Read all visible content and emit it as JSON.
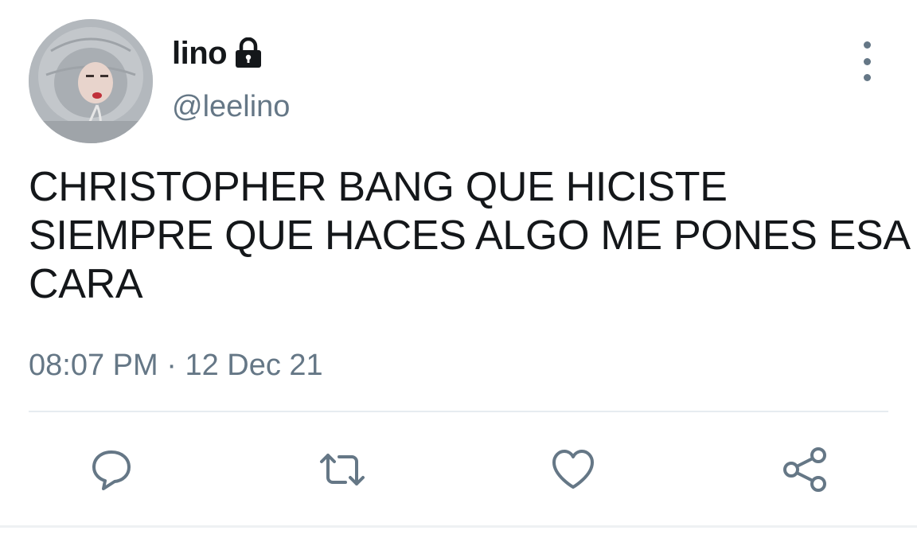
{
  "user": {
    "display_name": "lino",
    "handle": "@leelino",
    "avatar_icon": "avatar-photo",
    "protected_icon": "lock-icon"
  },
  "tweet": {
    "text_lines": [
      "CHRISTOPHER BANG QUE HICISTE",
      "SIEMPRE QUE HACES ALGO ME PONES ESA",
      "CARA"
    ],
    "time": "08:07 PM",
    "separator": "·",
    "date": "12 Dec 21"
  },
  "actions": [
    {
      "name": "reply",
      "icon": "reply-icon"
    },
    {
      "name": "retweet",
      "icon": "retweet-icon"
    },
    {
      "name": "like",
      "icon": "heart-icon"
    },
    {
      "name": "share",
      "icon": "share-icon"
    }
  ],
  "colors": {
    "text": "#14171a",
    "secondary": "#657786",
    "divider": "#e6ecf0"
  }
}
